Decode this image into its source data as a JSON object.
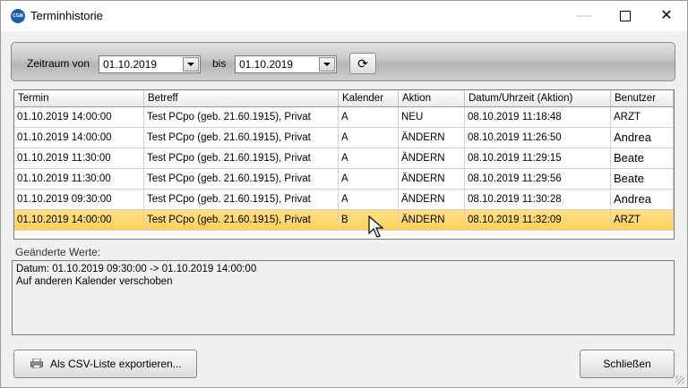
{
  "window": {
    "title": "Terminhistorie"
  },
  "toolbar": {
    "from_label": "Zeitraum von",
    "from_value": "01.10.2019",
    "to_label": "bis",
    "to_value": "01.10.2019"
  },
  "table": {
    "columns": [
      "Termin",
      "Betreff",
      "Kalender",
      "Aktion",
      "Datum/Uhrzeit (Aktion)",
      "Benutzer"
    ],
    "rows": [
      [
        "01.10.2019 14:00:00",
        "Test PCpo (geb. 21.60.1915), Privat",
        "A",
        "NEU",
        "08.10.2019 11:18:48",
        "ARZT"
      ],
      [
        "01.10.2019 14:00:00",
        "Test PCpo (geb. 21.60.1915), Privat",
        "A",
        "ÄNDERN",
        "08.10.2019 11:26:50",
        "Andrea"
      ],
      [
        "01.10.2019 11:30:00",
        "Test PCpo (geb. 21.60.1915), Privat",
        "A",
        "ÄNDERN",
        "08.10.2019 11:29:15",
        "Beate"
      ],
      [
        "01.10.2019 11:30:00",
        "Test PCpo (geb. 21.60.1915), Privat",
        "A",
        "ÄNDERN",
        "08.10.2019 11:29:56",
        "Beate"
      ],
      [
        "01.10.2019 09:30:00",
        "Test PCpo (geb. 21.60.1915), Privat",
        "A",
        "ÄNDERN",
        "08.10.2019 11:30:28",
        "Andrea"
      ],
      [
        "01.10.2019 14:00:00",
        "Test PCpo (geb. 21.60.1915), Privat",
        "B",
        "ÄNDERN",
        "08.10.2019 11:32:09",
        "ARZT"
      ]
    ],
    "selected_row": 6
  },
  "changes": {
    "label": "Geänderte Werte:",
    "lines": [
      "Datum: 01.10.2019 09:30:00 -> 01.10.2019 14:00:00",
      "Auf anderen Kalender verschoben"
    ]
  },
  "buttons": {
    "export_label": "Als CSV-Liste exportieren...",
    "close_label": "Schließen"
  },
  "colors": {
    "selection": "#ffd15a"
  }
}
